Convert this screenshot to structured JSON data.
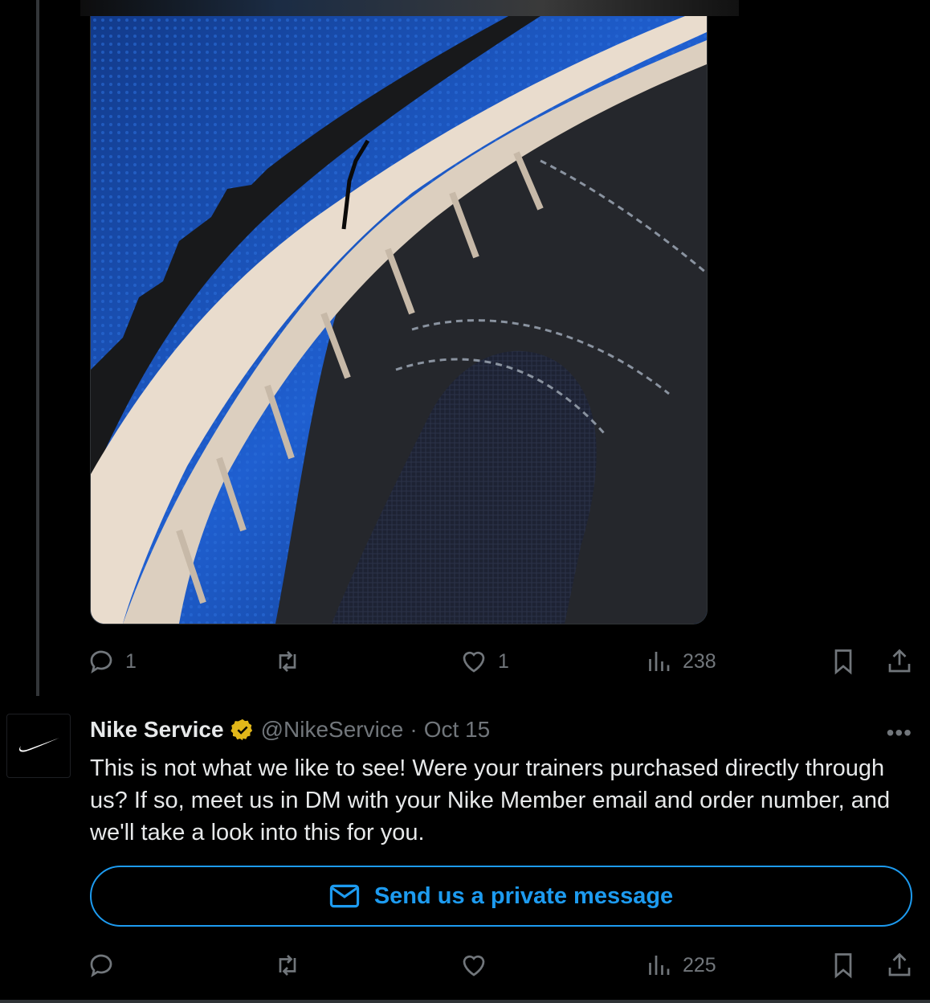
{
  "tweet_media": {
    "alt_icon": "sneaker-sole-crack-photo",
    "colors": {
      "sole": "#e9dccd",
      "upper": "#1f2126",
      "background": "#1d5cc6"
    }
  },
  "original_actions": {
    "reply_count": "1",
    "retweet_count": "",
    "like_count": "1",
    "views_count": "238"
  },
  "reply": {
    "name": "Nike Service",
    "handle": "@NikeService",
    "separator": "·",
    "date": "Oct 15",
    "more_label": "•••",
    "text": "This is not what we like to see! Were your trainers purchased directly through us? If so, meet us in DM with your Nike Member email and order number, and we'll take a look into this for you.",
    "dm_button_label": "Send us a private message",
    "actions": {
      "reply_count": "",
      "retweet_count": "",
      "like_count": "",
      "views_count": "225"
    }
  },
  "colors": {
    "accent": "#1d9bf0",
    "verified_badge": "#e2b719",
    "muted": "#71767b",
    "text": "#e7e9ea"
  }
}
